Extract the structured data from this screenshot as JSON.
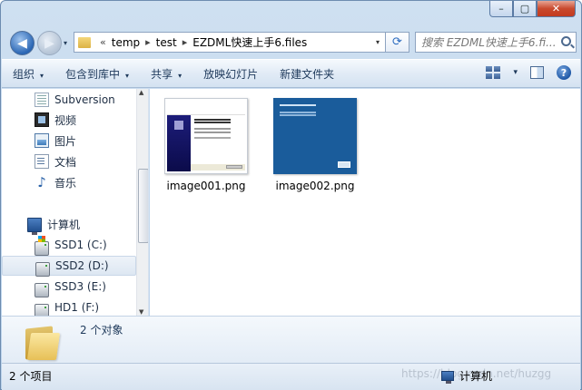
{
  "window": {
    "caption_buttons": {
      "minimize": "–",
      "maximize": "▢",
      "close": "✕"
    }
  },
  "navbar": {
    "back_glyph": "◀",
    "forward_glyph": "▶",
    "history_glyph": "▾",
    "address": {
      "chevrons": "«",
      "crumbs": [
        "temp",
        "test",
        "EZDML快速上手6.files"
      ],
      "separator": "▸",
      "dropdown_glyph": "▾"
    },
    "refresh_glyph": "⟳",
    "search_placeholder": "搜索 EZDML快速上手6.fi..."
  },
  "commandbar": {
    "items": [
      "组织",
      "包含到库中",
      "共享",
      "放映幻灯片",
      "新建文件夹"
    ],
    "arrow_glyph": "▾",
    "view_arrow": "▾",
    "help_glyph": "?"
  },
  "navpane": {
    "items": [
      {
        "label": "Subversion",
        "icon": "subversion-icon"
      },
      {
        "label": "视频",
        "icon": "video-icon"
      },
      {
        "label": "图片",
        "icon": "pictures-icon"
      },
      {
        "label": "文档",
        "icon": "documents-icon"
      },
      {
        "label": "音乐",
        "icon": "music-icon"
      },
      {
        "label": "计算机",
        "icon": "computer-icon"
      },
      {
        "label": "SSD1 (C:)",
        "icon": "system-drive-icon"
      },
      {
        "label": "SSD2 (D:)",
        "icon": "drive-icon",
        "selected": true
      },
      {
        "label": "SSD3 (E:)",
        "icon": "drive-icon"
      },
      {
        "label": "HD1 (F:)",
        "icon": "drive-icon"
      }
    ],
    "scroll_up": "▲",
    "scroll_down": "▼"
  },
  "files": [
    {
      "name": "image001.png"
    },
    {
      "name": "image002.png"
    }
  ],
  "details": {
    "count_text": "2 个对象"
  },
  "status": {
    "items_text": "2 个项目",
    "location_text": "计算机",
    "watermark": "https://blog.csdn.net/huzgg"
  },
  "colors": {
    "accent": "#1e395b",
    "frame": "#b9d1ea",
    "close": "#c94a2e"
  }
}
